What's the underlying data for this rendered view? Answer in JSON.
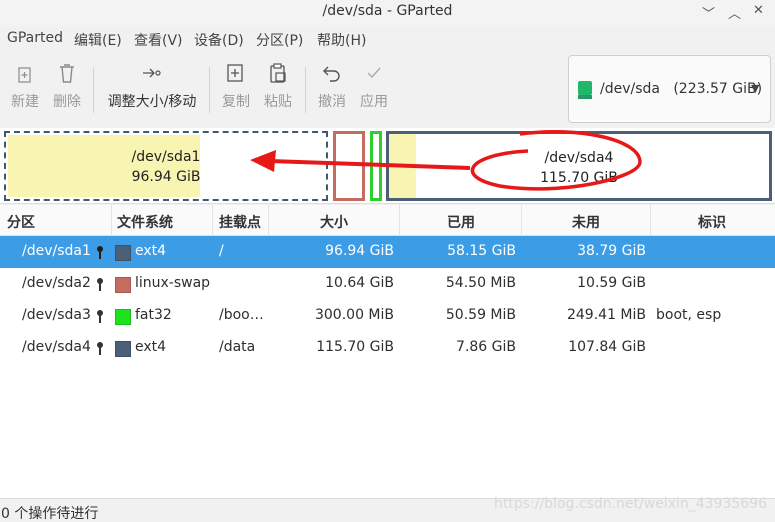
{
  "window": {
    "title": "/dev/sda - GParted",
    "controls": [
      "﹀",
      "︿",
      "✕"
    ]
  },
  "menu": [
    "GParted",
    "编辑(E)",
    "查看(V)",
    "设备(D)",
    "分区(P)",
    "帮助(H)"
  ],
  "toolbar": {
    "new": "新建",
    "delete": "删除",
    "resize_move": "调整大小/移动",
    "copy": "复制",
    "paste": "粘贴",
    "undo": "撤消",
    "apply": "应用"
  },
  "device": {
    "label": "/dev/sda",
    "size": "(223.57 GiB)",
    "icon": "disk-icon"
  },
  "map": {
    "sda1": {
      "name": "/dev/sda1",
      "size": "96.94 GiB",
      "used_fraction": 0.6,
      "color": "#3f5a6e"
    },
    "sda2": {
      "color": "#c46c60"
    },
    "sda3": {
      "color": "#2ccf2c"
    },
    "sda4": {
      "name": "/dev/sda4",
      "size": "115.70 GiB",
      "used_fraction": 0.07,
      "color": "#4b6078"
    },
    "annotation_color": "#e81818"
  },
  "table": {
    "headers": [
      "分区",
      "文件系统",
      "挂载点",
      "大小",
      "已用",
      "未用",
      "标识"
    ],
    "rows": [
      {
        "partition": "/dev/sda1",
        "fs": "ext4",
        "fs_color": "#4b6078",
        "mount": "/",
        "size": "96.94 GiB",
        "used": "58.15 GiB",
        "unused": "38.79 GiB",
        "flags": "",
        "selected": true
      },
      {
        "partition": "/dev/sda2",
        "fs": "linux-swap",
        "fs_color": "#c46c60",
        "mount": "",
        "size": "10.64 GiB",
        "used": "54.50 MiB",
        "unused": "10.59 GiB",
        "flags": "",
        "selected": false
      },
      {
        "partition": "/dev/sda3",
        "fs": "fat32",
        "fs_color": "#1ee21e",
        "mount": "/boo…",
        "size": "300.00 MiB",
        "used": "50.59 MiB",
        "unused": "249.41 MiB",
        "flags": "boot, esp",
        "selected": false
      },
      {
        "partition": "/dev/sda4",
        "fs": "ext4",
        "fs_color": "#4b6078",
        "mount": "/data",
        "size": "115.70 GiB",
        "used": "7.86 GiB",
        "unused": "107.84 GiB",
        "flags": "",
        "selected": false
      }
    ]
  },
  "status": "0 个操作待进行",
  "watermark": "https://blog.csdn.net/weixin_43935696"
}
